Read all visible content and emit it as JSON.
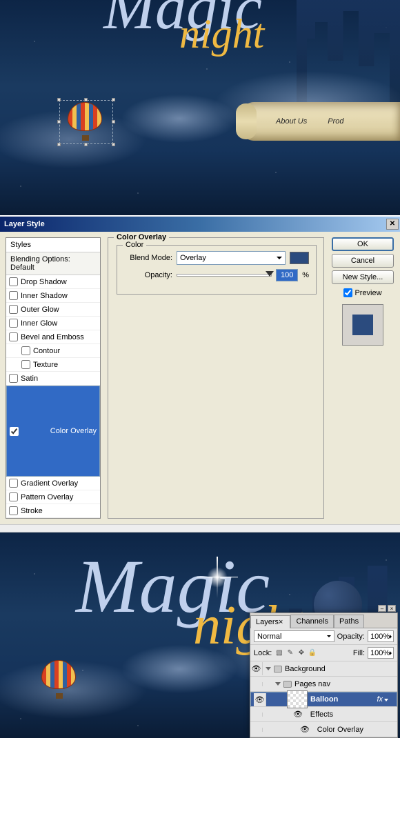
{
  "top_canvas": {
    "logo_main": "Magic",
    "logo_sub": "night",
    "nav": {
      "about": "About Us",
      "products": "Prod"
    }
  },
  "dialog": {
    "title": "Layer Style",
    "styles_header": "Styles",
    "blending_header": "Blending Options: Default",
    "effects": {
      "drop_shadow": "Drop Shadow",
      "inner_shadow": "Inner Shadow",
      "outer_glow": "Outer Glow",
      "inner_glow": "Inner Glow",
      "bevel": "Bevel and Emboss",
      "contour": "Contour",
      "texture": "Texture",
      "satin": "Satin",
      "color_overlay": "Color Overlay",
      "gradient_overlay": "Gradient Overlay",
      "pattern_overlay": "Pattern Overlay",
      "stroke": "Stroke"
    },
    "panel": {
      "group_label": "Color Overlay",
      "sub_label": "Color",
      "blend_mode_label": "Blend Mode:",
      "blend_mode_value": "Overlay",
      "opacity_label": "Opacity:",
      "opacity_value": "100",
      "opacity_unit": "%"
    },
    "buttons": {
      "ok": "OK",
      "cancel": "Cancel",
      "new_style": "New Style...",
      "preview": "Preview"
    }
  },
  "layers_panel": {
    "tabs": {
      "layers": "Layers",
      "channels": "Channels",
      "paths": "Paths"
    },
    "blend_mode": "Normal",
    "opacity_label": "Opacity:",
    "opacity_value": "100%",
    "lock_label": "Lock:",
    "fill_label": "Fill:",
    "fill_value": "100%",
    "layers": {
      "background_group": "Background",
      "pages_nav_group": "Pages nav",
      "balloon": "Balloon",
      "effects": "Effects",
      "color_overlay": "Color Overlay"
    },
    "fx_label": "fx"
  }
}
